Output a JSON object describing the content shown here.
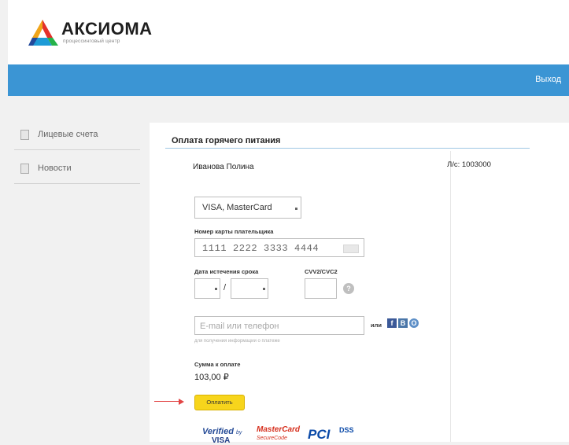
{
  "header": {
    "logo_title": "АКСИОМА",
    "logo_subtitle": "процессинговый центр",
    "logout_label": "Выход"
  },
  "sidebar": {
    "items": [
      {
        "label": "Лицевые счета"
      },
      {
        "label": "Новости"
      }
    ]
  },
  "main": {
    "title": "Оплата горячего питания",
    "user_name": "Иванова Полина",
    "account": "Л/с: 1003000",
    "payment_system_select": {
      "value": "VISA, MasterCard"
    },
    "card_number_label": "Номер карты плательщика",
    "card_number_value": "1111 2222 3333 4444",
    "expiry_label": "Дата истечения срока",
    "expiry_separator": "/",
    "cvv_label": "CVV2/CVC2",
    "help_symbol": "?",
    "email_placeholder": "E-mail или телефон",
    "email_hint": "для получения информации о платеже",
    "or_label": "или",
    "social": {
      "fb": "f",
      "vk": "В",
      "ok": "О"
    },
    "sum_label": "Сумма к оплате",
    "sum_value": "103,00 ₽",
    "pay_button": "Оплатить"
  },
  "footer_logos": {
    "verified_text": "Verified",
    "verified_by": "by",
    "verified_brand": "VISA",
    "mastercard_text": "MasterCard",
    "mastercard_sub": "SecureCode",
    "pci_text": "PCI",
    "dss_text": "DSS"
  },
  "colors": {
    "header_bar": "#3b95d4",
    "pay_button": "#f7d51c",
    "annotation_arrow": "#e24444"
  }
}
